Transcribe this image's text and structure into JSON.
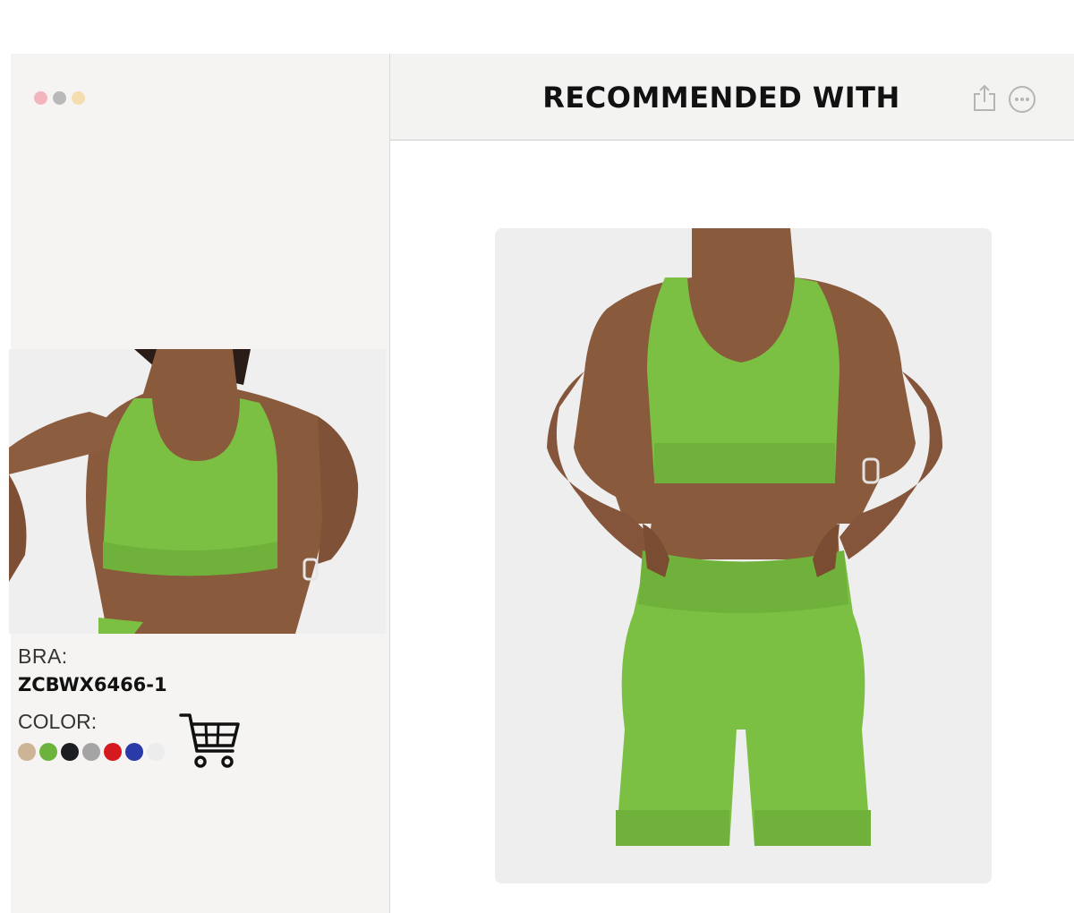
{
  "header": {
    "title": "RECOMMENDED WITH"
  },
  "window": {
    "dots": [
      "#f2b5bd",
      "#b9b9b9",
      "#f5ddb0"
    ]
  },
  "product": {
    "bra_label": "BRA:",
    "sku": "ZCBWX6466-1",
    "color_label": "COLOR:",
    "colors": [
      "#cdb497",
      "#6cb33e",
      "#1d1d24",
      "#a4a4a4",
      "#d41a1f",
      "#2a3aa8",
      "#ececec"
    ]
  },
  "icons": {
    "share": "share-icon",
    "more": "more-icon",
    "cart": "shopping-cart-icon"
  }
}
